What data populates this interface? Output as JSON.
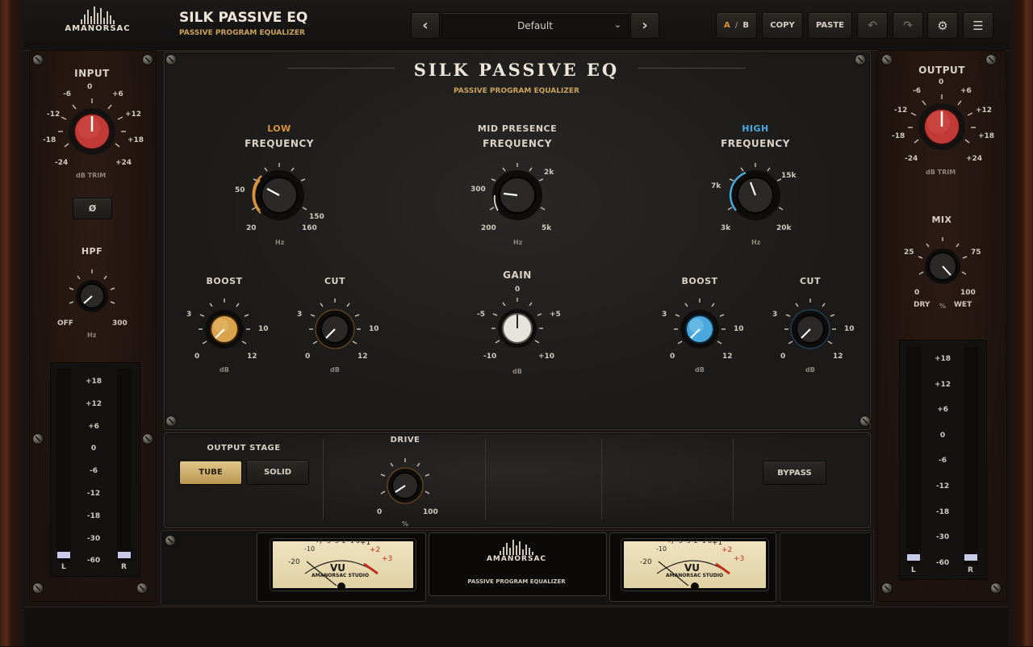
{
  "header": {
    "brand": "AMANORSAC",
    "title": "SILK PASSIVE EQ",
    "subtitle": "PASSIVE PROGRAM EQUALIZER",
    "preset": "Default",
    "ab": {
      "a": "A",
      "sep": "/",
      "b": "B"
    },
    "copy": "COPY",
    "paste": "PASTE"
  },
  "panel": {
    "title": "SILK PASSIVE EQ",
    "subtitle": "PASSIVE PROGRAM EQUALIZER"
  },
  "input": {
    "title": "INPUT",
    "ticks": [
      "0",
      "-6",
      "+6",
      "-12",
      "+12",
      "-18",
      "+18",
      "-24",
      "+24"
    ],
    "unit": "dB TRIM",
    "phase": "Ø",
    "hpf_title": "HPF",
    "hpf_min": "OFF",
    "hpf_max": "300",
    "hpf_unit": "Hz"
  },
  "low": {
    "tag": "LOW",
    "title": "FREQUENCY",
    "ticks": [
      "50",
      "150",
      "20",
      "160"
    ],
    "unit": "Hz",
    "boost": {
      "title": "BOOST",
      "ticks": [
        "3",
        "10",
        "0",
        "12"
      ],
      "unit": "dB"
    },
    "cut": {
      "title": "CUT",
      "ticks": [
        "3",
        "10",
        "0",
        "12"
      ],
      "unit": "dB"
    }
  },
  "mid": {
    "title1": "MID PRESENCE",
    "title2": "FREQUENCY",
    "ticks": [
      "2k",
      "300",
      "200",
      "5k"
    ],
    "unit": "Hz",
    "gain": {
      "title": "GAIN",
      "ticks": [
        "0",
        "-5",
        "+5",
        "-10",
        "+10"
      ],
      "unit": "dB"
    }
  },
  "high": {
    "tag": "HIGH",
    "title": "FREQUENCY",
    "ticks": [
      "7k",
      "15k",
      "3k",
      "20k"
    ],
    "unit": "Hz",
    "boost": {
      "title": "BOOST",
      "ticks": [
        "3",
        "10",
        "0",
        "12"
      ],
      "unit": "dB"
    },
    "cut": {
      "title": "CUT",
      "ticks": [
        "3",
        "10",
        "0",
        "12"
      ],
      "unit": "dB"
    }
  },
  "output": {
    "title": "OUTPUT",
    "ticks": [
      "0",
      "-6",
      "+6",
      "-12",
      "+12",
      "-18",
      "+18",
      "-24",
      "+24"
    ],
    "unit": "dB TRIM",
    "mix_title": "MIX",
    "mix_ticks": [
      "25",
      "75",
      "0",
      "100"
    ],
    "mix_dry": "DRY",
    "mix_pct": "%",
    "mix_wet": "WET"
  },
  "meter_scale": [
    "+18",
    "+12",
    "+6",
    "0",
    "-6",
    "-12",
    "-18",
    "-30",
    "-60"
  ],
  "meter_l": "L",
  "meter_r": "R",
  "stage": {
    "title": "OUTPUT STAGE",
    "tube": "TUBE",
    "solid": "SOLID",
    "drive_title": "DRIVE",
    "drive_min": "0",
    "drive_max": "100",
    "drive_unit": "%",
    "bypass": "BYPASS"
  },
  "vu": {
    "label": "VU",
    "maker": "AMANORSAC STUDIO",
    "scale": [
      "-20",
      "-10",
      "-7",
      "-5",
      "-3",
      "-2",
      "-1",
      "0",
      "+1",
      "+2",
      "+3"
    ]
  },
  "center_badge": {
    "brand": "AMANORSAC",
    "text": "PASSIVE PROGRAM EQUALIZER"
  },
  "colors": {
    "accent_gold": "#c9a25e",
    "low_orange": "#d8923a",
    "high_blue": "#4aa8dc",
    "input_red": "#c23a35"
  }
}
